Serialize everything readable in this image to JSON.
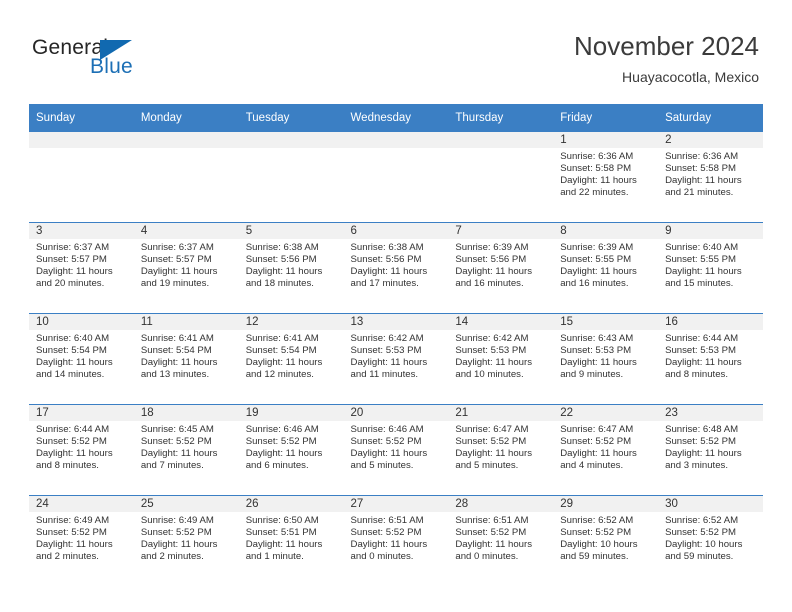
{
  "brand": {
    "word_one": "General",
    "word_two": "Blue",
    "triangle_color": "#1169b0",
    "blue_text_color": "#1c6fb5"
  },
  "header": {
    "title": "November 2024",
    "location": "Huayacocotla, Mexico"
  },
  "theme": {
    "header_blue": "#3b7fc4",
    "date_band_gray": "#f1f1f1",
    "text_color": "#333333"
  },
  "weekday_headers": [
    "Sunday",
    "Monday",
    "Tuesday",
    "Wednesday",
    "Thursday",
    "Friday",
    "Saturday"
  ],
  "weeks": [
    [
      {
        "date": "",
        "sunrise": "",
        "sunset": "",
        "daylight": ""
      },
      {
        "date": "",
        "sunrise": "",
        "sunset": "",
        "daylight": ""
      },
      {
        "date": "",
        "sunrise": "",
        "sunset": "",
        "daylight": ""
      },
      {
        "date": "",
        "sunrise": "",
        "sunset": "",
        "daylight": ""
      },
      {
        "date": "",
        "sunrise": "",
        "sunset": "",
        "daylight": ""
      },
      {
        "date": "1",
        "sunrise": "Sunrise: 6:36 AM",
        "sunset": "Sunset: 5:58 PM",
        "daylight": "Daylight: 11 hours and 22 minutes."
      },
      {
        "date": "2",
        "sunrise": "Sunrise: 6:36 AM",
        "sunset": "Sunset: 5:58 PM",
        "daylight": "Daylight: 11 hours and 21 minutes."
      }
    ],
    [
      {
        "date": "3",
        "sunrise": "Sunrise: 6:37 AM",
        "sunset": "Sunset: 5:57 PM",
        "daylight": "Daylight: 11 hours and 20 minutes."
      },
      {
        "date": "4",
        "sunrise": "Sunrise: 6:37 AM",
        "sunset": "Sunset: 5:57 PM",
        "daylight": "Daylight: 11 hours and 19 minutes."
      },
      {
        "date": "5",
        "sunrise": "Sunrise: 6:38 AM",
        "sunset": "Sunset: 5:56 PM",
        "daylight": "Daylight: 11 hours and 18 minutes."
      },
      {
        "date": "6",
        "sunrise": "Sunrise: 6:38 AM",
        "sunset": "Sunset: 5:56 PM",
        "daylight": "Daylight: 11 hours and 17 minutes."
      },
      {
        "date": "7",
        "sunrise": "Sunrise: 6:39 AM",
        "sunset": "Sunset: 5:56 PM",
        "daylight": "Daylight: 11 hours and 16 minutes."
      },
      {
        "date": "8",
        "sunrise": "Sunrise: 6:39 AM",
        "sunset": "Sunset: 5:55 PM",
        "daylight": "Daylight: 11 hours and 16 minutes."
      },
      {
        "date": "9",
        "sunrise": "Sunrise: 6:40 AM",
        "sunset": "Sunset: 5:55 PM",
        "daylight": "Daylight: 11 hours and 15 minutes."
      }
    ],
    [
      {
        "date": "10",
        "sunrise": "Sunrise: 6:40 AM",
        "sunset": "Sunset: 5:54 PM",
        "daylight": "Daylight: 11 hours and 14 minutes."
      },
      {
        "date": "11",
        "sunrise": "Sunrise: 6:41 AM",
        "sunset": "Sunset: 5:54 PM",
        "daylight": "Daylight: 11 hours and 13 minutes."
      },
      {
        "date": "12",
        "sunrise": "Sunrise: 6:41 AM",
        "sunset": "Sunset: 5:54 PM",
        "daylight": "Daylight: 11 hours and 12 minutes."
      },
      {
        "date": "13",
        "sunrise": "Sunrise: 6:42 AM",
        "sunset": "Sunset: 5:53 PM",
        "daylight": "Daylight: 11 hours and 11 minutes."
      },
      {
        "date": "14",
        "sunrise": "Sunrise: 6:42 AM",
        "sunset": "Sunset: 5:53 PM",
        "daylight": "Daylight: 11 hours and 10 minutes."
      },
      {
        "date": "15",
        "sunrise": "Sunrise: 6:43 AM",
        "sunset": "Sunset: 5:53 PM",
        "daylight": "Daylight: 11 hours and 9 minutes."
      },
      {
        "date": "16",
        "sunrise": "Sunrise: 6:44 AM",
        "sunset": "Sunset: 5:53 PM",
        "daylight": "Daylight: 11 hours and 8 minutes."
      }
    ],
    [
      {
        "date": "17",
        "sunrise": "Sunrise: 6:44 AM",
        "sunset": "Sunset: 5:52 PM",
        "daylight": "Daylight: 11 hours and 8 minutes."
      },
      {
        "date": "18",
        "sunrise": "Sunrise: 6:45 AM",
        "sunset": "Sunset: 5:52 PM",
        "daylight": "Daylight: 11 hours and 7 minutes."
      },
      {
        "date": "19",
        "sunrise": "Sunrise: 6:46 AM",
        "sunset": "Sunset: 5:52 PM",
        "daylight": "Daylight: 11 hours and 6 minutes."
      },
      {
        "date": "20",
        "sunrise": "Sunrise: 6:46 AM",
        "sunset": "Sunset: 5:52 PM",
        "daylight": "Daylight: 11 hours and 5 minutes."
      },
      {
        "date": "21",
        "sunrise": "Sunrise: 6:47 AM",
        "sunset": "Sunset: 5:52 PM",
        "daylight": "Daylight: 11 hours and 5 minutes."
      },
      {
        "date": "22",
        "sunrise": "Sunrise: 6:47 AM",
        "sunset": "Sunset: 5:52 PM",
        "daylight": "Daylight: 11 hours and 4 minutes."
      },
      {
        "date": "23",
        "sunrise": "Sunrise: 6:48 AM",
        "sunset": "Sunset: 5:52 PM",
        "daylight": "Daylight: 11 hours and 3 minutes."
      }
    ],
    [
      {
        "date": "24",
        "sunrise": "Sunrise: 6:49 AM",
        "sunset": "Sunset: 5:52 PM",
        "daylight": "Daylight: 11 hours and 2 minutes."
      },
      {
        "date": "25",
        "sunrise": "Sunrise: 6:49 AM",
        "sunset": "Sunset: 5:52 PM",
        "daylight": "Daylight: 11 hours and 2 minutes."
      },
      {
        "date": "26",
        "sunrise": "Sunrise: 6:50 AM",
        "sunset": "Sunset: 5:51 PM",
        "daylight": "Daylight: 11 hours and 1 minute."
      },
      {
        "date": "27",
        "sunrise": "Sunrise: 6:51 AM",
        "sunset": "Sunset: 5:52 PM",
        "daylight": "Daylight: 11 hours and 0 minutes."
      },
      {
        "date": "28",
        "sunrise": "Sunrise: 6:51 AM",
        "sunset": "Sunset: 5:52 PM",
        "daylight": "Daylight: 11 hours and 0 minutes."
      },
      {
        "date": "29",
        "sunrise": "Sunrise: 6:52 AM",
        "sunset": "Sunset: 5:52 PM",
        "daylight": "Daylight: 10 hours and 59 minutes."
      },
      {
        "date": "30",
        "sunrise": "Sunrise: 6:52 AM",
        "sunset": "Sunset: 5:52 PM",
        "daylight": "Daylight: 10 hours and 59 minutes."
      }
    ]
  ]
}
